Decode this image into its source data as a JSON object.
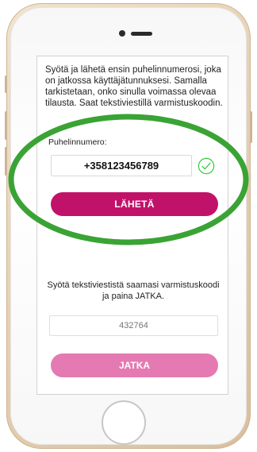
{
  "screen": {
    "instructions": "Syötä ja lähetä ensin puhelinnumerosi, joka on jatkossa käyttäjätunnuksesi. Samalla tarkistetaan, onko sinulla voimassa olevaa tilausta. Saat tekstiviestillä varmistuskoodin.",
    "phone_label": "Puhelinnumero:",
    "phone_value": "+358123456789",
    "send_label": "LÄHETÄ",
    "verify_text": "Syötä tekstiviestistä saamasi varmistuskoodi ja paina JATKA.",
    "code_placeholder": "432764",
    "continue_label": "JATKA"
  },
  "colors": {
    "primary_button": "#c1126a",
    "secondary_button": "#e47ab1",
    "check": "#2ecc40",
    "highlight": "#3aa335"
  },
  "icons": {
    "check": "check-circle-icon",
    "home": "home-button"
  }
}
